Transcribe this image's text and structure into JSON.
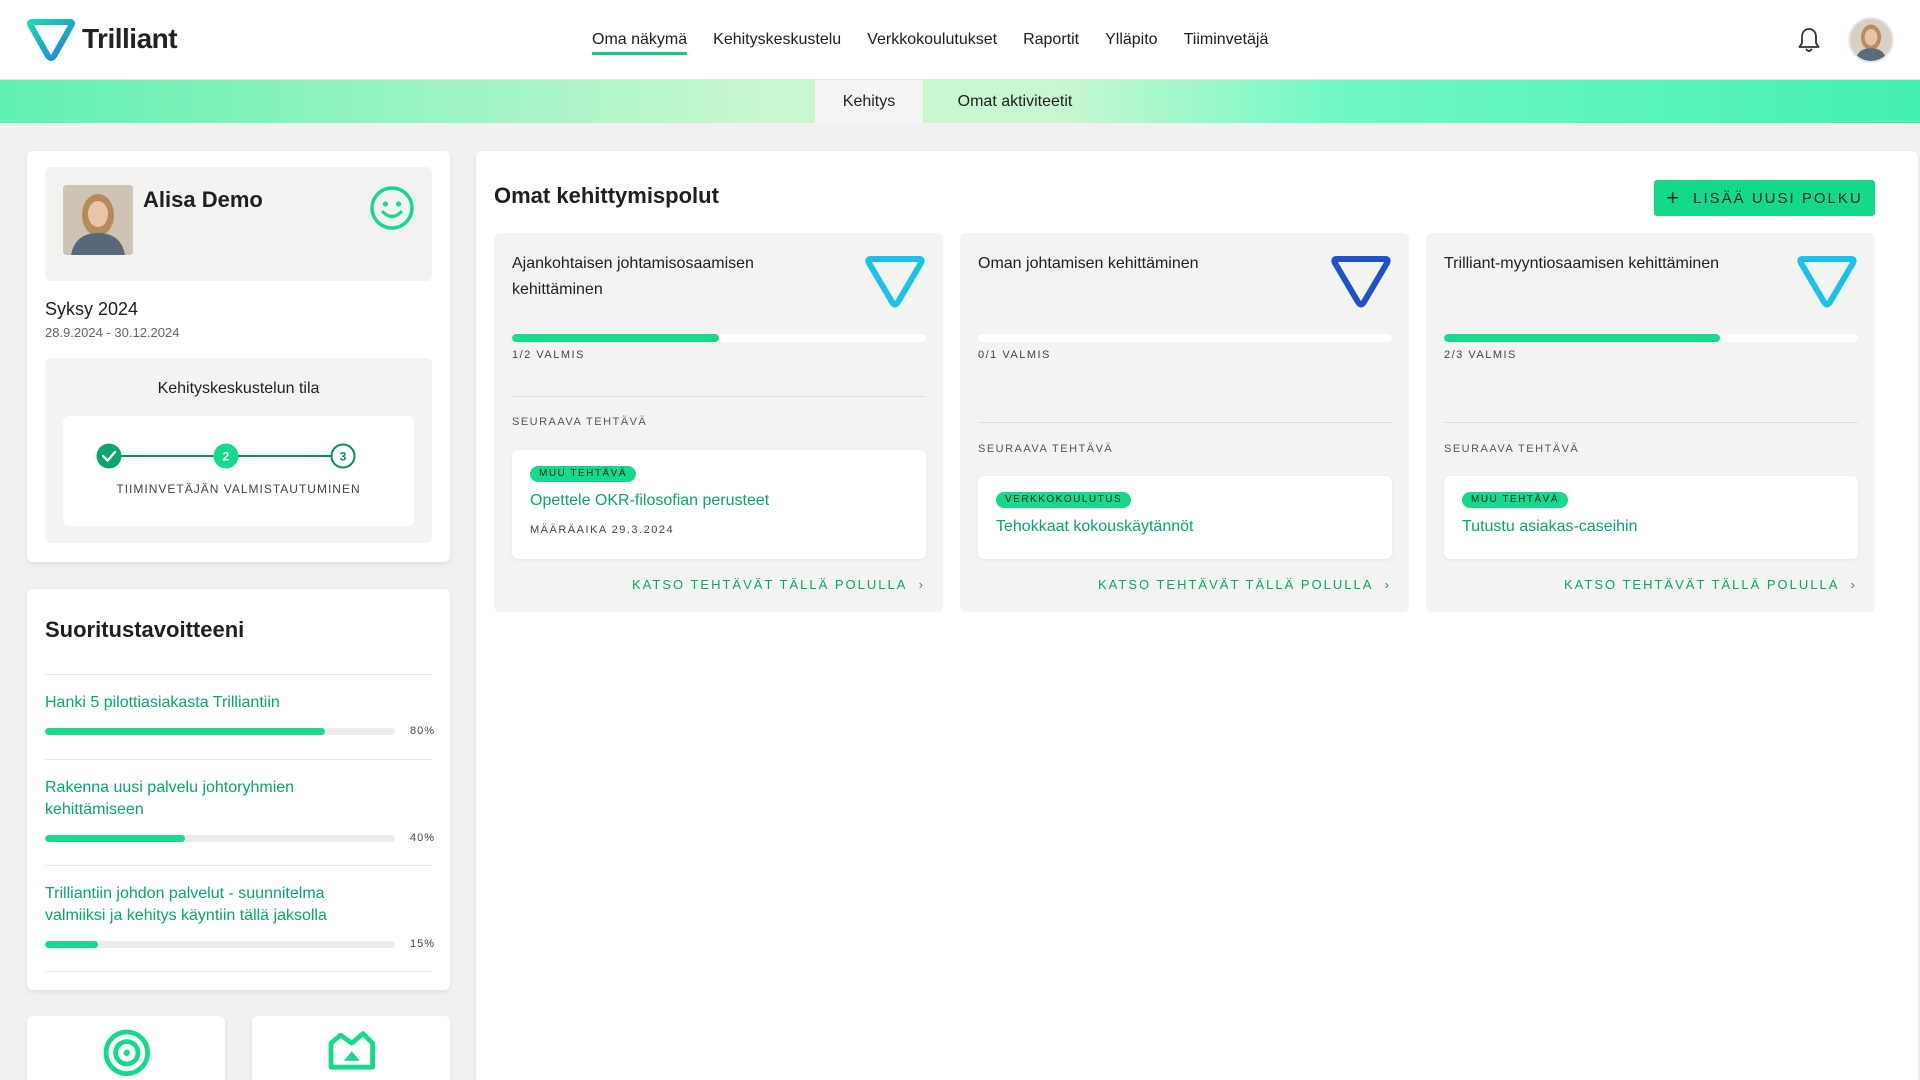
{
  "app": {
    "brand": "Trilliant",
    "accent_color": "#18d98d",
    "link_color": "#0aa66b"
  },
  "nav": {
    "items": [
      {
        "label": "Oma näkymä",
        "active": true
      },
      {
        "label": "Kehityskeskustelu",
        "active": false
      },
      {
        "label": "Verkkokoulutukset",
        "active": false
      },
      {
        "label": "Raportit",
        "active": false
      },
      {
        "label": "Ylläpito",
        "active": false
      },
      {
        "label": "Tiiminvetäjä",
        "active": false
      }
    ],
    "icons": {
      "notifications": "bell-icon",
      "user": "avatar"
    }
  },
  "subnav": {
    "tabs": [
      {
        "label": "Kehitys",
        "active": true
      },
      {
        "label": "Omat aktiviteetit",
        "active": false
      }
    ]
  },
  "profile": {
    "name": "Alisa Demo",
    "mood_icon": "smiley-icon",
    "season": "Syksy 2024",
    "dates": "28.9.2024 - 30.12.2024",
    "status": {
      "title": "Kehityskeskustelun tila",
      "steps": [
        {
          "label": "",
          "state": "done"
        },
        {
          "label": "2",
          "state": "current"
        },
        {
          "label": "3",
          "state": "upcoming"
        }
      ],
      "current_step_caption": "TIIMINVETÄJÄN VALMISTAUTUMINEN"
    }
  },
  "goals": {
    "title": "Suoritustavoitteeni",
    "items": [
      {
        "label": "Hanki 5 pilottiasiakasta Trilliantiin",
        "percent_text": "80%",
        "progress": 0.8
      },
      {
        "label": "Rakenna uusi palvelu johtoryhmien kehittämiseen",
        "percent_text": "40%",
        "progress": 0.4
      },
      {
        "label": "Trilliantiin johdon palvelut - suunnitelma valmiiksi ja kehitys käyntiin tällä jaksolla",
        "percent_text": "15%",
        "progress": 0.15
      }
    ]
  },
  "paths": {
    "title": "Omat kehittymispolut",
    "add_button": "LISÄÄ UUSI POLKU",
    "next_task_label": "SEURAAVA TEHTÄVÄ",
    "see_all_label": "KATSO TEHTÄVÄT TÄLLÄ POLULLA",
    "cards": [
      {
        "title": "Ajankohtaisen johtamisosaamisen kehittäminen",
        "logo_color": "#1cc1ea",
        "progress": 0.5,
        "count": "1/2 VALMIS",
        "task": {
          "badge": "MUU TEHTÄVÄ",
          "title": "Opettele OKR-filosofian perusteet",
          "due": "MÄÄRÄAIKA 29.3.2024"
        }
      },
      {
        "title": "Oman johtamisen kehittäminen",
        "logo_color": "#1f4fc9",
        "progress": 0.0,
        "count": "0/1 VALMIS",
        "task": {
          "badge": "VERKKOKOULUTUS",
          "title": "Tehokkaat kokouskäytännöt",
          "due": ""
        }
      },
      {
        "title": "Trilliant-myyntiosaamisen kehittäminen",
        "logo_color": "#1cc1ea",
        "progress": 0.667,
        "count": "2/3 VALMIS",
        "task": {
          "badge": "MUU TEHTÄVÄ",
          "title": "Tutustu asiakas-caseihin",
          "due": ""
        }
      }
    ]
  },
  "bottom_icons": [
    "target-icon",
    "crown-icon"
  ]
}
